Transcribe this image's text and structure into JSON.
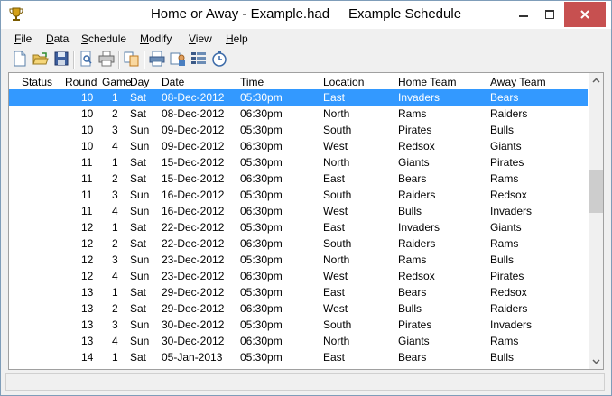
{
  "window": {
    "title": "Home or Away - Example.had     Example Schedule"
  },
  "menu": [
    "File",
    "Data",
    "Schedule",
    "Modify",
    "View",
    "Help"
  ],
  "toolbar": {
    "buttons": [
      "new-file-icon",
      "open-folder-icon",
      "save-disk-icon",
      "print-preview-icon",
      "print-icon",
      "copy-icon",
      "print-schedule-icon",
      "team-icon",
      "list-icon",
      "clock-icon"
    ]
  },
  "grid": {
    "columns": [
      "Status",
      "Round",
      "Game",
      "Day",
      "Date",
      "Time",
      "Location",
      "Home Team",
      "Away Team"
    ],
    "selected_index": 0,
    "rows": [
      [
        "",
        "10",
        "1",
        "Sat",
        "08-Dec-2012",
        "05:30pm",
        "East",
        "Invaders",
        "Bears"
      ],
      [
        "",
        "10",
        "2",
        "Sat",
        "08-Dec-2012",
        "06:30pm",
        "North",
        "Rams",
        "Raiders"
      ],
      [
        "",
        "10",
        "3",
        "Sun",
        "09-Dec-2012",
        "05:30pm",
        "South",
        "Pirates",
        "Bulls"
      ],
      [
        "",
        "10",
        "4",
        "Sun",
        "09-Dec-2012",
        "06:30pm",
        "West",
        "Redsox",
        "Giants"
      ],
      [
        "",
        "11",
        "1",
        "Sat",
        "15-Dec-2012",
        "05:30pm",
        "North",
        "Giants",
        "Pirates"
      ],
      [
        "",
        "11",
        "2",
        "Sat",
        "15-Dec-2012",
        "06:30pm",
        "East",
        "Bears",
        "Rams"
      ],
      [
        "",
        "11",
        "3",
        "Sun",
        "16-Dec-2012",
        "05:30pm",
        "South",
        "Raiders",
        "Redsox"
      ],
      [
        "",
        "11",
        "4",
        "Sun",
        "16-Dec-2012",
        "06:30pm",
        "West",
        "Bulls",
        "Invaders"
      ],
      [
        "",
        "12",
        "1",
        "Sat",
        "22-Dec-2012",
        "05:30pm",
        "East",
        "Invaders",
        "Giants"
      ],
      [
        "",
        "12",
        "2",
        "Sat",
        "22-Dec-2012",
        "06:30pm",
        "South",
        "Raiders",
        "Rams"
      ],
      [
        "",
        "12",
        "3",
        "Sun",
        "23-Dec-2012",
        "05:30pm",
        "North",
        "Rams",
        "Bulls"
      ],
      [
        "",
        "12",
        "4",
        "Sun",
        "23-Dec-2012",
        "06:30pm",
        "West",
        "Redsox",
        "Pirates"
      ],
      [
        "",
        "13",
        "1",
        "Sat",
        "29-Dec-2012",
        "05:30pm",
        "East",
        "Bears",
        "Redsox"
      ],
      [
        "",
        "13",
        "2",
        "Sat",
        "29-Dec-2012",
        "06:30pm",
        "West",
        "Bulls",
        "Raiders"
      ],
      [
        "",
        "13",
        "3",
        "Sun",
        "30-Dec-2012",
        "05:30pm",
        "South",
        "Pirates",
        "Invaders"
      ],
      [
        "",
        "13",
        "4",
        "Sun",
        "30-Dec-2012",
        "06:30pm",
        "North",
        "Giants",
        "Rams"
      ],
      [
        "",
        "14",
        "1",
        "Sat",
        "05-Jan-2013",
        "05:30pm",
        "East",
        "Bears",
        "Bulls"
      ]
    ]
  },
  "colors": {
    "selection": "#3399ff",
    "close_button": "#c75050"
  }
}
